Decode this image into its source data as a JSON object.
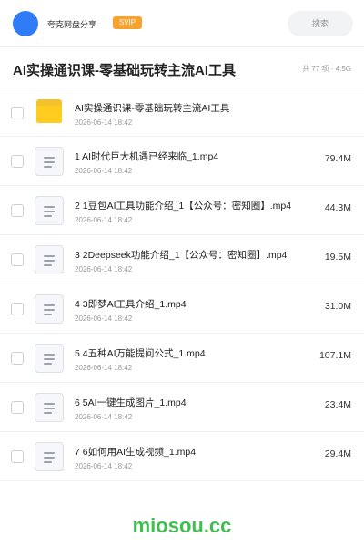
{
  "header": {
    "user_name": "夸克网盘分享",
    "badge": "SVIP",
    "search_label": "搜索"
  },
  "folder": {
    "title": "AI实操通识课-零基础玩转主流AI工具",
    "meta": "共 77 项 · 4.5G"
  },
  "items": [
    {
      "type": "folder",
      "name": "AI实操通识课-零基础玩转主流AI工具",
      "date": "2026-06-14 18:42",
      "size": ""
    },
    {
      "type": "file",
      "name": "1 AI时代巨大机遇已经来临_1.mp4",
      "date": "2026-06-14 18:42",
      "size": "79.4M"
    },
    {
      "type": "file",
      "name": "2 1豆包AI工具功能介绍_1【公众号：密知圈】.mp4",
      "date": "2026-06-14 18:42",
      "size": "44.3M"
    },
    {
      "type": "file",
      "name": "3 2Deepseek功能介绍_1【公众号：密知圈】.mp4",
      "date": "2026-06-14 18:42",
      "size": "19.5M"
    },
    {
      "type": "file",
      "name": "4 3即梦AI工具介绍_1.mp4",
      "date": "2026-06-14 18:42",
      "size": "31.0M"
    },
    {
      "type": "file",
      "name": "5 4五种AI万能提问公式_1.mp4",
      "date": "2026-06-14 18:42",
      "size": "107.1M"
    },
    {
      "type": "file",
      "name": "6 5AI一键生成图片_1.mp4",
      "date": "2026-06-14 18:42",
      "size": "23.4M"
    },
    {
      "type": "file",
      "name": "7 6如何用AI生成视频_1.mp4",
      "date": "2026-06-14 18:42",
      "size": "29.4M"
    }
  ],
  "watermark": "miosou.cc",
  "colors": {
    "accent_blue": "#2f7cf6",
    "svip_orange": "#f7a12e",
    "folder_yellow": "#ffcc1f",
    "watermark_green": "#3fbf4f"
  },
  "icons": {
    "folder": "folder-icon",
    "file": "file-icon"
  }
}
